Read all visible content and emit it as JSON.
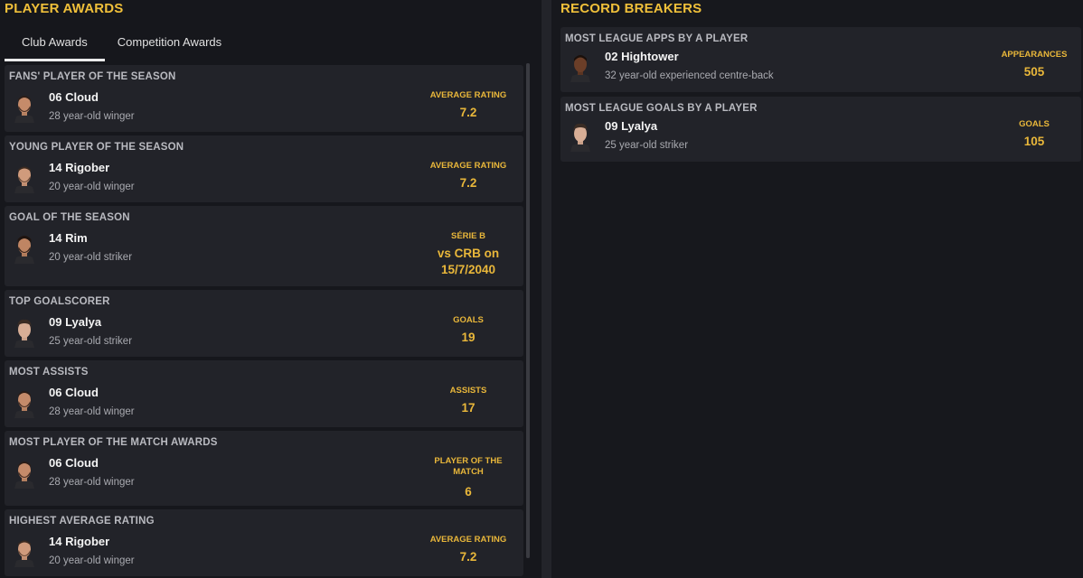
{
  "left": {
    "title": "PLAYER AWARDS",
    "tabs": [
      {
        "label": "Club Awards",
        "active": true
      },
      {
        "label": "Competition Awards",
        "active": false
      }
    ],
    "awards": [
      {
        "title": "FANS' PLAYER OF THE SEASON",
        "player": "06 Cloud",
        "desc": "28 year-old winger",
        "stat_label": "AVERAGE RATING",
        "stat_value": "7.2"
      },
      {
        "title": "YOUNG PLAYER OF THE SEASON",
        "player": "14 Rigober",
        "desc": "20 year-old winger",
        "stat_label": "AVERAGE RATING",
        "stat_value": "7.2"
      },
      {
        "title": "GOAL OF THE SEASON",
        "player": "14 Rim",
        "desc": "20 year-old striker",
        "stat_label": "SÉRIE B",
        "stat_value": "vs CRB on 15/7/2040"
      },
      {
        "title": "TOP GOALSCORER",
        "player": "09 Lyalya",
        "desc": "25 year-old striker",
        "stat_label": "GOALS",
        "stat_value": "19"
      },
      {
        "title": "MOST ASSISTS",
        "player": "06 Cloud",
        "desc": "28 year-old winger",
        "stat_label": "ASSISTS",
        "stat_value": "17"
      },
      {
        "title": "MOST PLAYER OF THE MATCH AWARDS",
        "player": "06 Cloud",
        "desc": "28 year-old winger",
        "stat_label": "PLAYER OF THE MATCH",
        "stat_value": "6"
      },
      {
        "title": "HIGHEST AVERAGE RATING",
        "player": "14 Rigober",
        "desc": "20 year-old winger",
        "stat_label": "AVERAGE RATING",
        "stat_value": "7.2"
      }
    ]
  },
  "right": {
    "title": "RECORD BREAKERS",
    "records": [
      {
        "title": "MOST LEAGUE APPS BY A PLAYER",
        "player": "02 Hightower",
        "desc": "32 year-old experienced centre-back",
        "stat_label": "APPEARANCES",
        "stat_value": "505"
      },
      {
        "title": "MOST LEAGUE GOALS BY A PLAYER",
        "player": "09 Lyalya",
        "desc": "25 year-old striker",
        "stat_label": "GOALS",
        "stat_value": "105"
      }
    ]
  },
  "colors": {
    "accent": "#f0c03a",
    "stat": "#e9b73a",
    "card": "#222329",
    "background": "#16171c"
  }
}
